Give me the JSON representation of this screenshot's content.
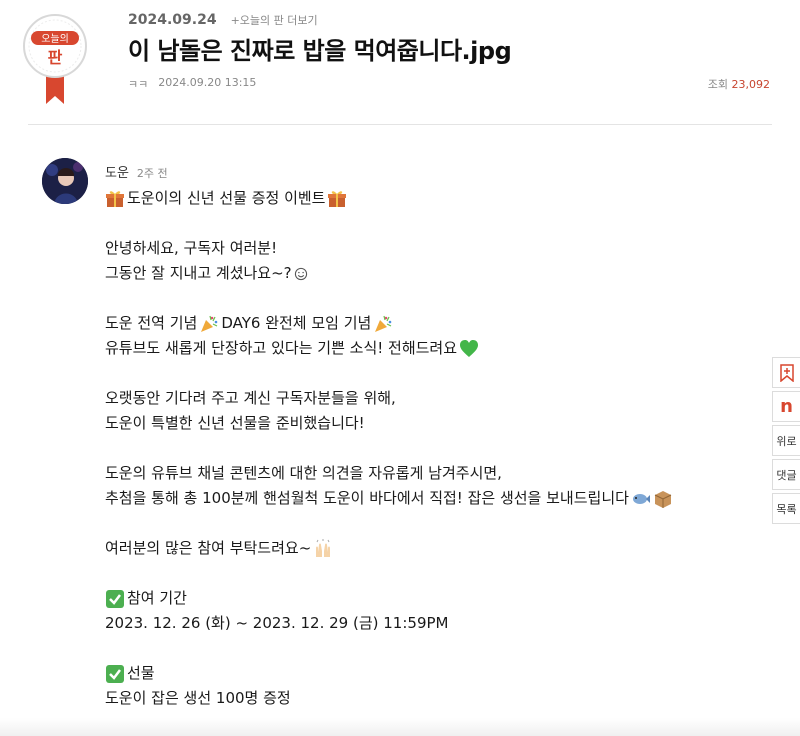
{
  "header": {
    "badge_text_top": "오늘의",
    "badge_text_main": "판",
    "date": "2024.09.24",
    "more_link": "+오늘의 판 더보기",
    "title": "이 남돌은 진짜로 밥을 먹여줍니다.jpg",
    "author": "ㅋㅋ",
    "posted_at": "2024.09.20 13:15",
    "views_label": "조회",
    "views_count": "23,092"
  },
  "comment": {
    "author": "도운",
    "time_ago": "2주 전"
  },
  "post_lines": {
    "l1": "도운이의 신년 선물 증정 이벤트",
    "l2": "안녕하세요, 구독자 여러분!",
    "l3": "그동안 잘 지내고 계셨나요~?",
    "l4a": "도운 전역 기념",
    "l4b": " DAY6 완전체 모임 기념",
    "l5": "유튜브도 새롭게 단장하고 있다는 기쁜 소식! 전해드려요",
    "l6": "오랫동안 기다려 주고 계신 구독자분들을 위해,",
    "l7": "도운이 특별한 신년 선물을 준비했습니다!",
    "l8": "도운의 유튜브 채널 콘텐츠에 대한 의견을 자유롭게 남겨주시면,",
    "l9": "추첨을 통해 총 100분께 핸섬월척 도운이 바다에서 직접! 잡은 생선을 보내드립니다",
    "l10": "여러분의 많은 참여 부탁드려요~",
    "l11": "참여 기간",
    "l12": "2023. 12. 26 (화) ~ 2023. 12. 29 (금) 11:59PM",
    "l13": "선물",
    "l14": "도운이 잡은 생선 100명 증정"
  },
  "side_buttons": {
    "bookmark": "bookmark-icon",
    "naver": "n",
    "top": "위로",
    "comments": "댓글",
    "list": "목록"
  },
  "colors": {
    "accent": "#d8472f",
    "badge_ring": "#d0d0d0",
    "check_green": "#4caf50",
    "heart_green": "#43b649"
  }
}
